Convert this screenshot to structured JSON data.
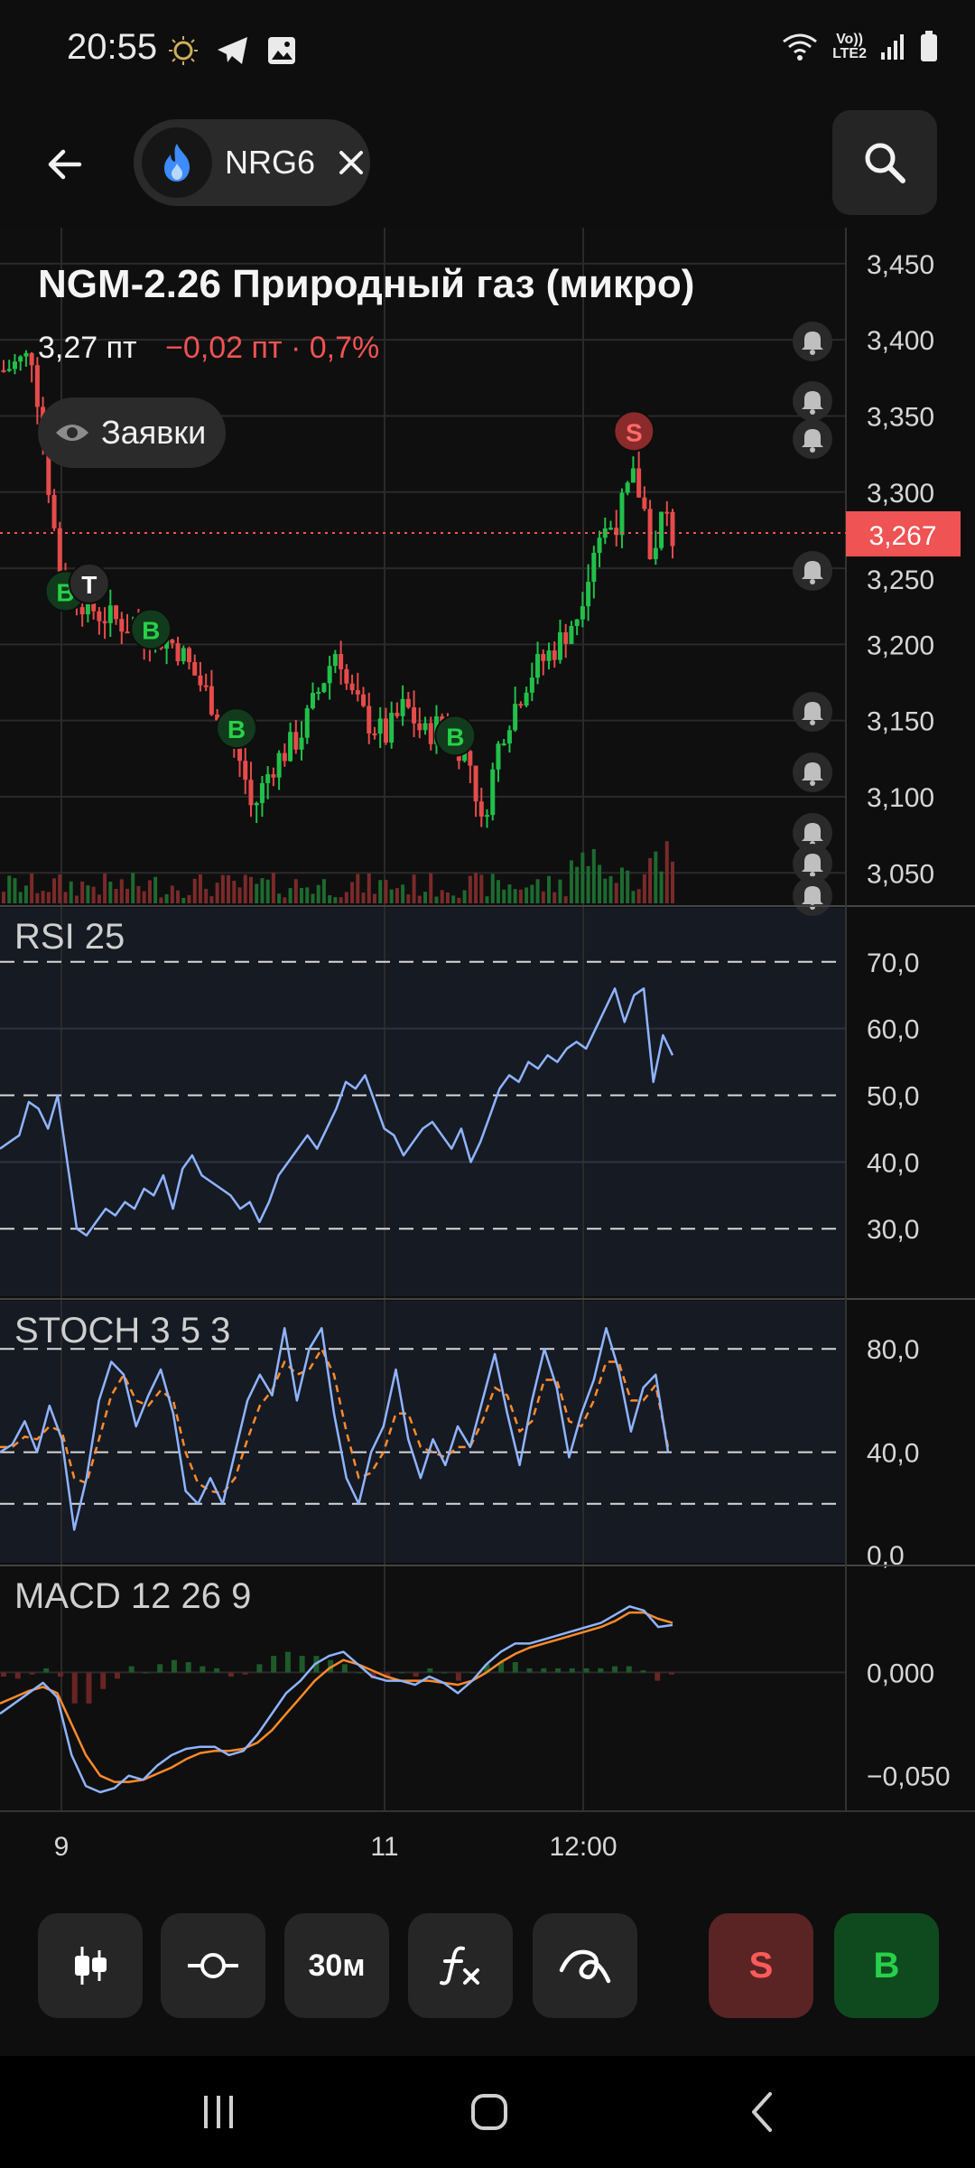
{
  "status_bar": {
    "time": "20:55",
    "network_label_top": "Vo))",
    "network_label_bottom": "LTE2"
  },
  "header": {
    "ticker": "NRG6",
    "icons": {
      "back": "arrow-left-icon",
      "logo": "flame-icon",
      "close": "close-icon",
      "search": "search-icon"
    }
  },
  "instrument": {
    "title": "NGM-2.26 Природный газ (микро)",
    "price": "3,27 пт",
    "change": "−0,02 пт · 0,7%",
    "orders_label": "Заявки",
    "current_price_tag": "3,267"
  },
  "colors": {
    "up": "#21c04a",
    "down": "#e64b4b",
    "accent_red": "#f05353",
    "line_blue": "#8fb4ff",
    "line_orange": "#ff8a2a",
    "signal_sell_bg": "#8b2a2a",
    "signal_buy_bg": "#123a1c"
  },
  "chart_data": [
    {
      "type": "line",
      "panel": "price",
      "kind": "candlestick",
      "y_ticks": [
        "3,450",
        "3,400",
        "3,350",
        "3,300",
        "3,250",
        "3,200",
        "3,150",
        "3,100",
        "3,050"
      ],
      "ylim": [
        3.03,
        3.46
      ],
      "x_ticks": [
        "9",
        "11",
        "12:00"
      ],
      "current": 3.267,
      "close_path": [
        [
          0,
          3.38
        ],
        [
          0.03,
          3.39
        ],
        [
          0.06,
          3.24
        ],
        [
          0.1,
          3.22
        ],
        [
          0.14,
          3.21
        ],
        [
          0.18,
          3.2
        ],
        [
          0.2,
          3.18
        ],
        [
          0.23,
          3.15
        ],
        [
          0.25,
          3.12
        ],
        [
          0.26,
          3.09
        ],
        [
          0.28,
          3.12
        ],
        [
          0.31,
          3.14
        ],
        [
          0.33,
          3.17
        ],
        [
          0.35,
          3.2
        ],
        [
          0.36,
          3.17
        ],
        [
          0.38,
          3.15
        ],
        [
          0.4,
          3.14
        ],
        [
          0.42,
          3.16
        ],
        [
          0.44,
          3.14
        ],
        [
          0.46,
          3.15
        ],
        [
          0.49,
          3.12
        ],
        [
          0.5,
          3.08
        ],
        [
          0.52,
          3.14
        ],
        [
          0.55,
          3.18
        ],
        [
          0.58,
          3.2
        ],
        [
          0.6,
          3.22
        ],
        [
          0.62,
          3.27
        ],
        [
          0.64,
          3.28
        ],
        [
          0.66,
          3.31
        ],
        [
          0.67,
          3.29
        ],
        [
          0.68,
          3.25
        ],
        [
          0.69,
          3.29
        ],
        [
          0.7,
          3.27
        ]
      ],
      "signals": [
        {
          "label": "B",
          "x": 0.065,
          "price": 3.235,
          "kind": "buy"
        },
        {
          "label": "T",
          "x": 0.09,
          "price": 3.24,
          "kind": "neutral"
        },
        {
          "label": "B",
          "x": 0.155,
          "price": 3.21,
          "kind": "buy"
        },
        {
          "label": "B",
          "x": 0.245,
          "price": 3.145,
          "kind": "buy"
        },
        {
          "label": "B",
          "x": 0.475,
          "price": 3.14,
          "kind": "buy"
        },
        {
          "label": "S",
          "x": 0.663,
          "price": 3.34,
          "kind": "sell"
        }
      ]
    },
    {
      "type": "line",
      "panel": "RSI",
      "label": "RSI 25",
      "y_ticks": [
        "70,0",
        "60,0",
        "50,0",
        "40,0",
        "30,0"
      ],
      "ylim": [
        28,
        72
      ],
      "levels": [
        70,
        50,
        30
      ],
      "series": [
        {
          "name": "RSI",
          "values": [
            42,
            43,
            44,
            49,
            48,
            45,
            50,
            40,
            30,
            29,
            31,
            33,
            32,
            34,
            33,
            36,
            35,
            38,
            33,
            39,
            41,
            38,
            37,
            36,
            35,
            33,
            34,
            31,
            34,
            38,
            40,
            42,
            44,
            42,
            45,
            48,
            52,
            51,
            53,
            49,
            45,
            44,
            41,
            43,
            45,
            46,
            44,
            42,
            45,
            40,
            43,
            47,
            51,
            53,
            52,
            55,
            54,
            56,
            55,
            57,
            58,
            57,
            60,
            63,
            66,
            61,
            65,
            66,
            52,
            59,
            56
          ]
        }
      ]
    },
    {
      "type": "line",
      "panel": "STOCH",
      "label": "STOCH 3 5 3",
      "y_ticks": [
        "80,0",
        "40,0",
        "0,0"
      ],
      "ylim": [
        0,
        100
      ],
      "levels": [
        80,
        40,
        20
      ],
      "series": [
        {
          "name": "%K",
          "values": [
            40,
            43,
            52,
            40,
            58,
            45,
            10,
            30,
            60,
            75,
            70,
            50,
            62,
            72,
            55,
            25,
            20,
            30,
            20,
            40,
            60,
            70,
            62,
            88,
            60,
            80,
            88,
            55,
            30,
            20,
            40,
            50,
            72,
            45,
            30,
            45,
            35,
            50,
            42,
            60,
            78,
            55,
            35,
            60,
            80,
            65,
            38,
            55,
            68,
            88,
            72,
            48,
            65,
            70,
            40
          ]
        },
        {
          "name": "%D",
          "values": [
            42,
            42,
            46,
            45,
            50,
            48,
            30,
            28,
            45,
            62,
            70,
            60,
            58,
            64,
            60,
            40,
            28,
            25,
            24,
            30,
            45,
            58,
            64,
            75,
            70,
            72,
            80,
            70,
            48,
            30,
            32,
            40,
            55,
            55,
            42,
            40,
            38,
            42,
            42,
            52,
            65,
            62,
            48,
            52,
            68,
            68,
            52,
            50,
            60,
            75,
            75,
            60,
            60,
            66,
            42
          ]
        }
      ]
    },
    {
      "type": "line",
      "panel": "MACD",
      "label": "MACD 12 26 9",
      "y_ticks": [
        "0,000",
        "−0,050"
      ],
      "ylim": [
        -0.065,
        0.04
      ],
      "series": [
        {
          "name": "MACD",
          "values": [
            -0.02,
            -0.015,
            -0.01,
            -0.005,
            -0.012,
            -0.04,
            -0.055,
            -0.058,
            -0.056,
            -0.05,
            -0.052,
            -0.045,
            -0.04,
            -0.037,
            -0.036,
            -0.036,
            -0.04,
            -0.038,
            -0.03,
            -0.02,
            -0.01,
            -0.004,
            0.004,
            0.008,
            0.01,
            0.004,
            -0.002,
            -0.004,
            -0.004,
            -0.006,
            -0.002,
            -0.005,
            -0.01,
            -0.004,
            0.004,
            0.01,
            0.014,
            0.014,
            0.016,
            0.018,
            0.02,
            0.022,
            0.024,
            0.028,
            0.032,
            0.03,
            0.022,
            0.023
          ]
        },
        {
          "name": "Signal",
          "values": [
            -0.015,
            -0.012,
            -0.009,
            -0.007,
            -0.01,
            -0.025,
            -0.04,
            -0.05,
            -0.053,
            -0.053,
            -0.052,
            -0.049,
            -0.046,
            -0.042,
            -0.039,
            -0.038,
            -0.038,
            -0.037,
            -0.034,
            -0.028,
            -0.02,
            -0.012,
            -0.004,
            0.002,
            0.006,
            0.004,
            0.001,
            -0.002,
            -0.004,
            -0.004,
            -0.004,
            -0.005,
            -0.006,
            -0.004,
            0.0,
            0.005,
            0.009,
            0.012,
            0.014,
            0.016,
            0.018,
            0.02,
            0.022,
            0.025,
            0.029,
            0.029,
            0.026,
            0.024
          ]
        },
        {
          "name": "Histogram",
          "values": [
            -0.002,
            -0.003,
            -0.001,
            0.002,
            -0.002,
            -0.015,
            -0.015,
            -0.008,
            -0.003,
            0.003,
            0.0,
            0.004,
            0.006,
            0.005,
            0.003,
            0.002,
            -0.002,
            -0.001,
            0.004,
            0.008,
            0.01,
            0.008,
            0.008,
            0.006,
            0.004,
            0.0,
            -0.003,
            -0.002,
            0.0,
            -0.002,
            0.002,
            0.0,
            -0.004,
            0.0,
            0.004,
            0.005,
            0.005,
            0.002,
            0.002,
            0.002,
            0.002,
            0.002,
            0.002,
            0.003,
            0.003,
            0.001,
            -0.004,
            -0.001
          ]
        }
      ]
    }
  ],
  "alert_icons": "bell-icon",
  "toolbar": {
    "chart_type_icon": "candlestick-icon",
    "indicator_icon": "line-node-icon",
    "timeframe_label": "30м",
    "fx_label": "fx",
    "draw_icon": "drawing-icon",
    "sell_label": "S",
    "buy_label": "B"
  },
  "nav": {
    "recents": "recents-icon",
    "home": "home-icon",
    "back": "back-icon"
  }
}
